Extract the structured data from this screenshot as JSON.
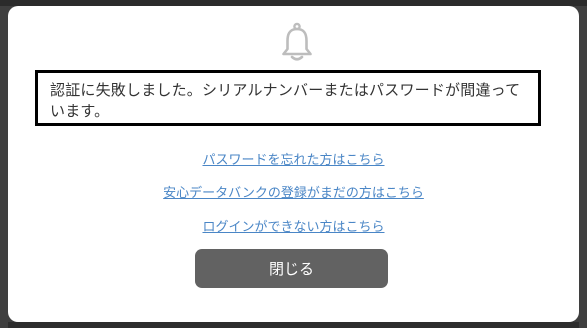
{
  "dialog": {
    "icon": "bell-icon",
    "message": "認証に失敗しました。シリアルナンバーまたはパスワードが間違っています。",
    "links": [
      {
        "label": "パスワードを忘れた方はこちら"
      },
      {
        "label": "安心データバンクの登録がまだの方はこちら"
      },
      {
        "label": "ログインができない方はこちら"
      }
    ],
    "close_label": "閉じる"
  },
  "colors": {
    "link": "#4a86c6",
    "button": "#626262",
    "icon": "#bdbdbd"
  }
}
